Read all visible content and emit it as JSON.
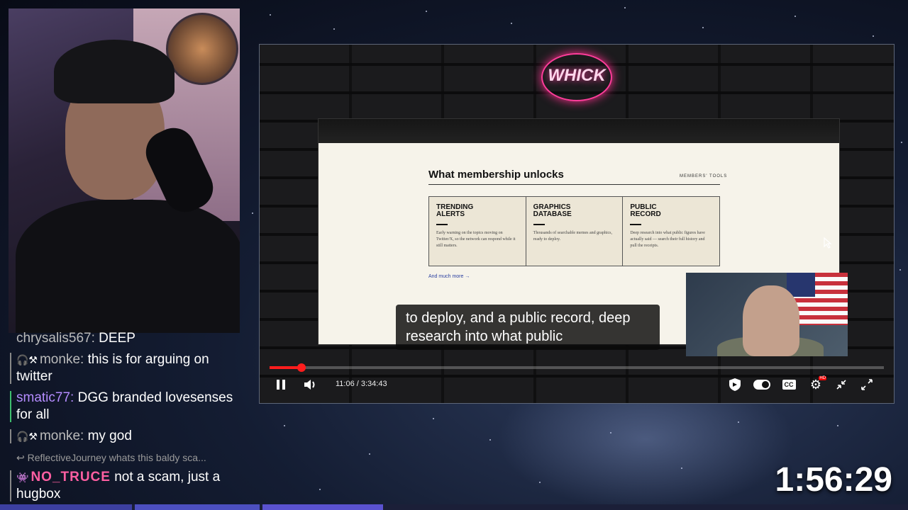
{
  "chat": {
    "messages": [
      {
        "user": "chrysalis567",
        "text": "DEEP"
      },
      {
        "user": "monke",
        "text": "this is for arguing on twitter",
        "badges": "🎧⚒"
      },
      {
        "user": "smatic77",
        "text": "DGG branded lovesenses for all"
      },
      {
        "user": "monke",
        "text": "my god",
        "badges": "🎧⚒"
      },
      {
        "reply": "↩ ReflectiveJourney whats this baldy sca..."
      },
      {
        "user": "NO_TRUCE",
        "text": "not a scam, just a hugbox",
        "badges": "👾"
      }
    ]
  },
  "player": {
    "logo": "WHICK",
    "screen": {
      "title": "What membership unlocks",
      "tag": "MEMBERS' TOOLS",
      "cards": [
        {
          "title": "TRENDING ALERTS",
          "body": "Early warning on the topics moving on Twitter/X, so the network can respond while it still matters."
        },
        {
          "title": "GRAPHICS DATABASE",
          "body": "Thousands of searchable memes and graphics, ready to deploy."
        },
        {
          "title": "PUBLIC RECORD",
          "body": "Deep research into what public figures have actually said — search their full history and pull the receipts."
        }
      ],
      "more_link": "And much more →"
    },
    "caption": "to deploy, and a public record, deep research into what public",
    "time": "11:06 / 3:34:43",
    "progress_fraction": 0.0516,
    "icons": {
      "play_pause": "pause-icon",
      "volume": "volume-icon",
      "shield": "shield-icon",
      "autoplay": "autoplay-toggle",
      "cc": "CC",
      "settings": "gear-icon",
      "hd_badge": "HD",
      "minimize": "minimize-icon",
      "fullscreen": "fullscreen-icon"
    }
  },
  "stream_timer": "1:56:29",
  "colors": {
    "accent_red": "#ff1d1d",
    "neon_pink": "#ff3d9b",
    "chat_purple": "#b48cff"
  }
}
